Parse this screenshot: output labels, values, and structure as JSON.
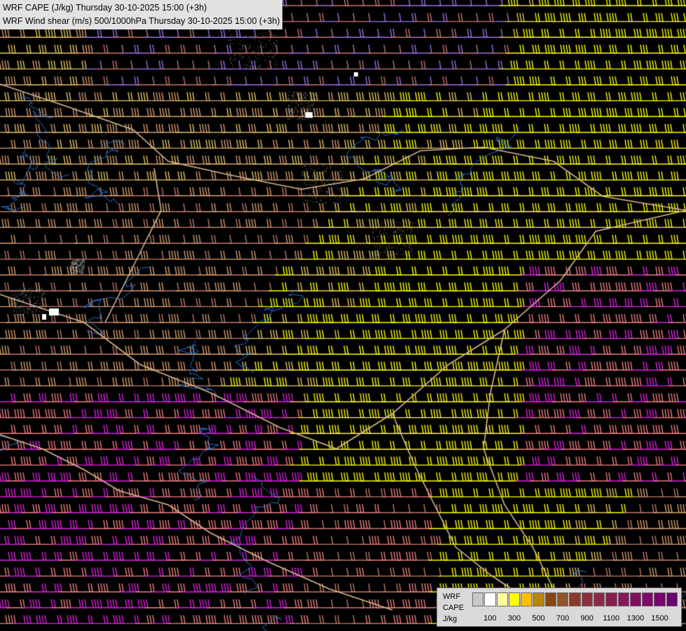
{
  "header": {
    "line1": "WRF CAPE (J/kg) Thursday 30-10-2025 15:00 (+3h)",
    "line2": "WRF Wind shear (m/s) 500/1000hPa Thursday 30-10-2025 15:00 (+3h)"
  },
  "legend": {
    "model": "WRF",
    "variable": "CAPE",
    "unit": "J/kg",
    "ticks": [
      "100",
      "300",
      "500",
      "700",
      "900",
      "1100",
      "1300",
      "1500"
    ],
    "colors": [
      "#c8c8c8",
      "#ffffff",
      "#ffff9a",
      "#ffff00",
      "#ffbf00",
      "#b8860b",
      "#8b4513",
      "#92532a",
      "#8b3a2a",
      "#8b2f3c",
      "#8a2a48",
      "#891f4f",
      "#86185a",
      "#830f61",
      "#800868",
      "#7a0070",
      "#6b0070"
    ]
  },
  "map": {
    "background_color": "#000000",
    "barb_colors": {
      "weak": "#c07a6a",
      "tan": "#d9a070",
      "light_yellow": "#e8c860",
      "yellow": "#ffff00",
      "salmon": "#f08080",
      "magenta": "#e020e0",
      "lavender": "#a070e0"
    },
    "border_color": "#d8b890",
    "river_color": "#2a70c8",
    "coast_color": "#ffffff"
  }
}
